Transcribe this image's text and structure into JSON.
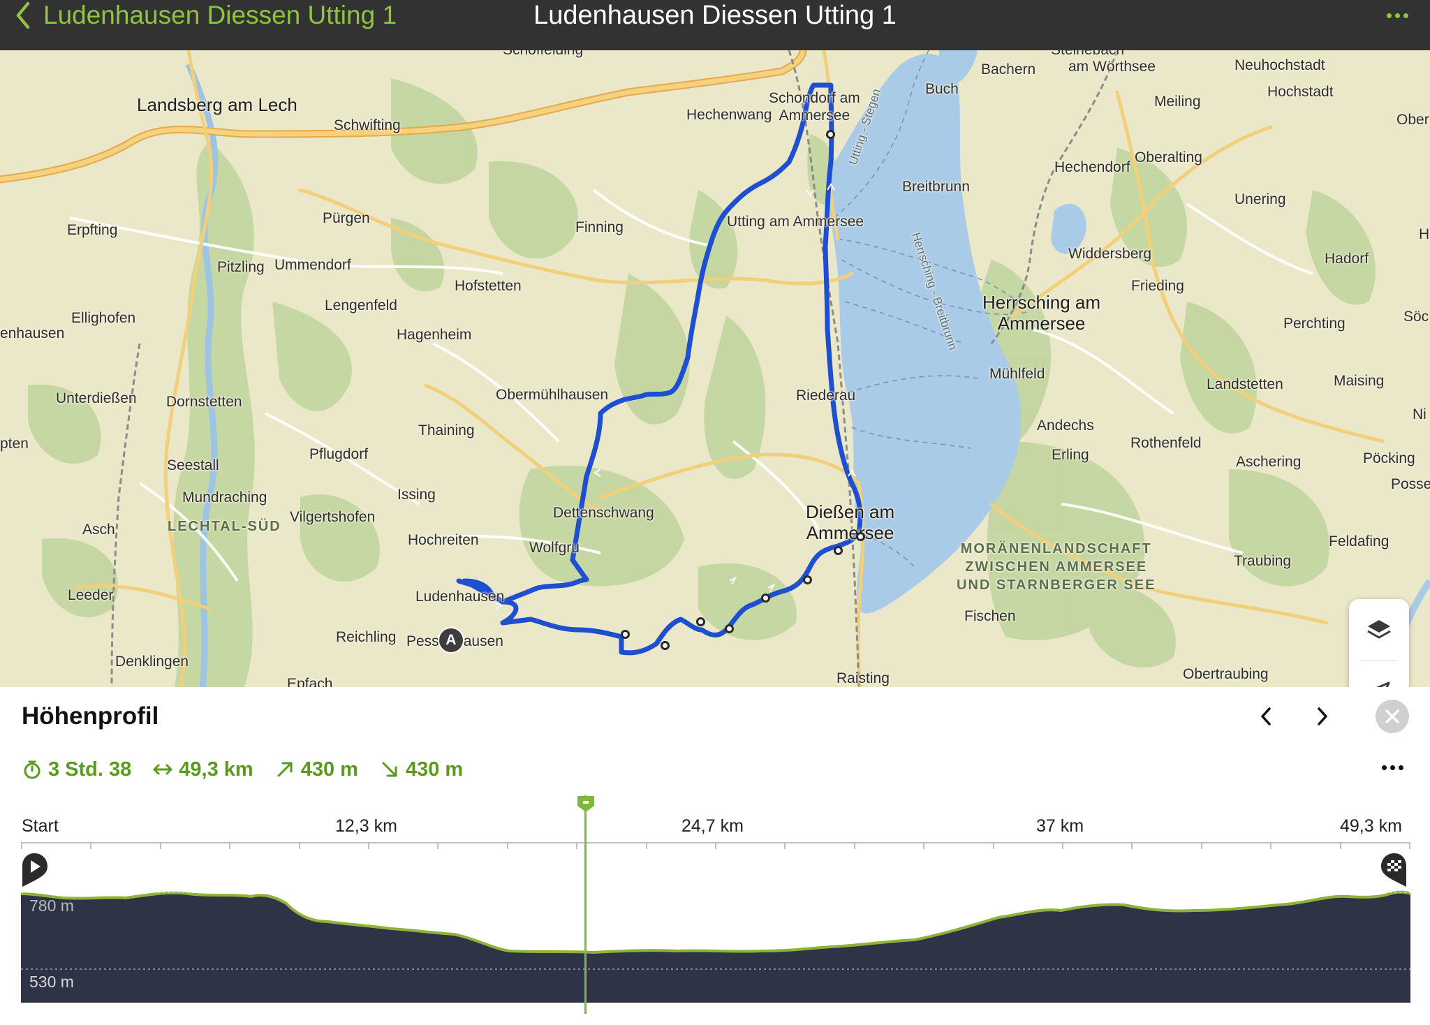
{
  "header": {
    "back_label": "Ludenhausen Diessen Utting 1",
    "title": "Ludenhausen Diessen Utting 1"
  },
  "map": {
    "places": {
      "landsberg": "Landsberg am Lech",
      "schwifting": "Schwifting",
      "schondorf": "Schondorf am\nAmmersee",
      "hechenwang": "Hechenwang",
      "bachern": "Bachern",
      "buch": "Buch",
      "woerthsee": "am Wörthsee",
      "neuhochstadt": "Neuhochstadt",
      "hochstadt": "Hochstadt",
      "meiling": "Meiling",
      "ober": "Ober",
      "hechendorf": "Hechendorf",
      "oberalting": "Oberalting",
      "breitbrunn": "Breitbrunn",
      "unering": "Unering",
      "erpfting": "Erpfting",
      "puergen": "Pürgen",
      "finning": "Finning",
      "utting": "Utting am Ammersee",
      "widdersberg": "Widdersberg",
      "hadorf": "Hadorf",
      "pitzling": "Pitzling",
      "ummendorf": "Ummendorf",
      "hofstetten": "Hofstetten",
      "frieding": "Frieding",
      "herrsching": "Herrsching am\nAmmersee",
      "perchting": "Perchting",
      "elliighofen": "Ellighofen",
      "lengenfeld": "Lengenfeld",
      "hagenheim": "Hagenheim",
      "enhausen": "enhausen",
      "muehlfeld": "Mühlfeld",
      "landstetten": "Landstetten",
      "maising": "Maising",
      "unterdiessen": "Unterdießen",
      "dornstetten": "Dornstetten",
      "obermuehlhausen": "Obermühlhausen",
      "riederau": "Riederau",
      "andechs": "Andechs",
      "thaining": "Thaining",
      "pten": "pten",
      "pflugdorf": "Pflugdorf",
      "rothenfeld": "Rothenfeld",
      "erling": "Erling",
      "aschering": "Aschering",
      "poecking": "Pöcking",
      "seestall": "Seestall",
      "mundraching": "Mundraching",
      "issing": "Issing",
      "dettenschwang": "Dettenschwang",
      "diessen": "Dießen am\nAmmersee",
      "possenh": "Possenh",
      "asch": "Asch",
      "lechtal": "LECHTAL-SÜD",
      "vilgertshofen": "Vilgertshofen",
      "hochreiten": "Hochreiten",
      "wolfgruben": "Wolfgru",
      "moraenen": "MORÄNENLANDSCHAFT\nZWISCHEN AMMERSEE\nUND STARNBERGER SEE",
      "feldafing": "Feldafing",
      "traubing": "Traubing",
      "leeder": "Leeder",
      "ludenhausen": "Ludenhausen",
      "fischen": "Fischen",
      "reichling": "Reichling",
      "pessenhausen": "Pessenhausen",
      "denklingen": "Denklingen",
      "raisting": "Raisting",
      "obertraubing": "Obertraubing",
      "schoffelding": "Schöffelding",
      "steinebach": "Steinebach",
      "epfach": "Epfach",
      "soec": "Söc",
      "ni": "Ni",
      "h": "H"
    },
    "lake_labels": {
      "utting_stegen": "Utting - Stegen",
      "herrsching_breitbrunn": "Herrsching - Breitbrunn"
    },
    "start_marker": "A",
    "colors": {
      "route": "#1f4fd1",
      "lake": "#a9cbe8",
      "forest": "#bfd49a",
      "field": "#ebe7c9",
      "road_major": "#f3c466"
    }
  },
  "panel": {
    "title": "Höhenprofil",
    "stats": {
      "duration": "3 Std. 38",
      "distance": "49,3 km",
      "ascent": "430 m",
      "descent": "430 m"
    },
    "ruler": {
      "labels": [
        "Start",
        "12,3 km",
        "24,7 km",
        "37 km",
        "49,3 km"
      ]
    },
    "altitude": {
      "high_label": "780 m",
      "low_label": "530 m"
    },
    "colors": {
      "accent": "#5a9a1f",
      "profile_fill": "#2e3445",
      "profile_stroke": "#8fb23a"
    }
  }
}
